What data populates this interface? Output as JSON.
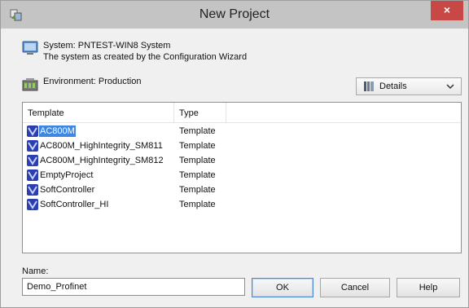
{
  "window": {
    "title": "New Project",
    "close_label": "×"
  },
  "system": {
    "line1": "System: PNTEST-WIN8 System",
    "line2": "The system as created by the Configuration Wizard"
  },
  "environment": {
    "label": "Environment: Production"
  },
  "view_select": {
    "value": "Details"
  },
  "list": {
    "columns": [
      "Template",
      "Type"
    ],
    "rows": [
      {
        "name": "AC800M",
        "type": "Template",
        "selected": true
      },
      {
        "name": "AC800M_HighIntegrity_SM811",
        "type": "Template",
        "selected": false
      },
      {
        "name": "AC800M_HighIntegrity_SM812",
        "type": "Template",
        "selected": false
      },
      {
        "name": "EmptyProject",
        "type": "Template",
        "selected": false
      },
      {
        "name": "SoftController",
        "type": "Template",
        "selected": false
      },
      {
        "name": "SoftController_HI",
        "type": "Template",
        "selected": false
      }
    ]
  },
  "name_field": {
    "label": "Name:",
    "value": "Demo_Profinet"
  },
  "buttons": {
    "ok": "OK",
    "cancel": "Cancel",
    "help": "Help"
  },
  "colors": {
    "selection": "#3f86e0",
    "close_button": "#c74845",
    "titlebar": "#c4c4c4"
  },
  "icons": {
    "app": "project-app-icon",
    "system": "system-monitor-icon",
    "environment": "environment-icon",
    "view": "details-view-icon",
    "template": "template-icon"
  }
}
